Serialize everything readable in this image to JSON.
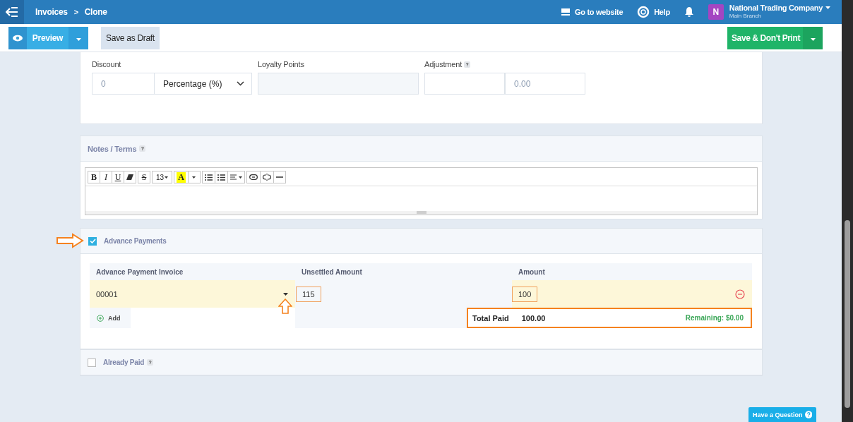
{
  "topbar": {
    "breadcrumb": [
      {
        "label": "Invoices"
      },
      {
        "label": "Clone"
      }
    ],
    "separator": ">",
    "go_to_website": "Go to website",
    "help": "Help",
    "avatar_letter": "N",
    "company": "National Trading Company",
    "branch": "Main Branch"
  },
  "actions": {
    "preview": "Preview",
    "save_draft": "Save as Draft",
    "save": "Save & Don't Print"
  },
  "discount": {
    "label": "Discount",
    "value": "0",
    "type": "Percentage (%)"
  },
  "loyalty": {
    "label": "Loyalty Points"
  },
  "adjustment": {
    "label": "Adjustment",
    "help": "?",
    "placeholder": "0.00"
  },
  "notes": {
    "title": "Notes / Terms",
    "help": "?",
    "toolbar_labels": [
      "B",
      "I",
      "U",
      "S",
      "13",
      "A"
    ]
  },
  "advance": {
    "label": "Advance Payments",
    "checked": true,
    "columns": [
      "Advance Payment Invoice",
      "Unsettled Amount",
      "Amount"
    ],
    "row": {
      "invoice": "00001",
      "unsettled": "115",
      "amount": "100"
    },
    "add": "Add",
    "total_label": "Total Paid",
    "total": "100.00",
    "remaining": "Remaining: $0.00"
  },
  "already_paid": {
    "label": "Already Paid",
    "help": "?",
    "checked": false
  },
  "question_button": "Have a Question"
}
